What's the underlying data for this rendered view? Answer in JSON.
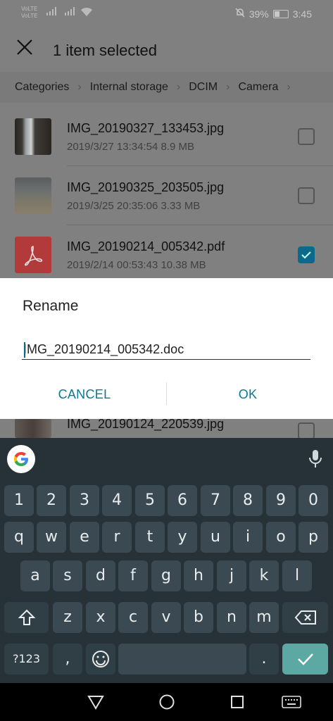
{
  "status_bar": {
    "sim1": "VoLTE",
    "sim2": "VoLTE",
    "battery": "39%",
    "time": "3:45"
  },
  "header": {
    "title": "1 item selected"
  },
  "breadcrumb": [
    "Categories",
    "Internal storage",
    "DCIM",
    "Camera"
  ],
  "files": [
    {
      "name": "IMG_20190327_133453.jpg",
      "meta": "2019/3/27 13:34:54 8.9 MB",
      "selected": false
    },
    {
      "name": "IMG_20190325_203505.jpg",
      "meta": "2019/3/25 20:35:06 3.33 MB",
      "selected": false
    },
    {
      "name": "IMG_20190214_005342.pdf",
      "meta": "2019/2/14 00:53:43 10.38 MB",
      "selected": true
    },
    {
      "name": "IMG_20190124_220539.jpg",
      "meta": "",
      "selected": false
    }
  ],
  "dialog": {
    "title": "Rename",
    "input_value": "IMG_20190214_005342.doc",
    "cancel": "CANCEL",
    "ok": "OK"
  },
  "keyboard": {
    "row_numbers": [
      "1",
      "2",
      "3",
      "4",
      "5",
      "6",
      "7",
      "8",
      "9",
      "0"
    ],
    "row1": [
      "q",
      "w",
      "e",
      "r",
      "t",
      "y",
      "u",
      "i",
      "o",
      "p"
    ],
    "row2": [
      "a",
      "s",
      "d",
      "f",
      "g",
      "h",
      "j",
      "k",
      "l"
    ],
    "row3": [
      "z",
      "x",
      "c",
      "v",
      "b",
      "n",
      "m"
    ],
    "sym_key": "?123",
    "comma": ",",
    "period": "."
  },
  "colors": {
    "accent": "#0a7890",
    "keyboard_bg": "#263238",
    "key_bg": "#3b4a52",
    "enter_key": "#5ba9a2"
  }
}
